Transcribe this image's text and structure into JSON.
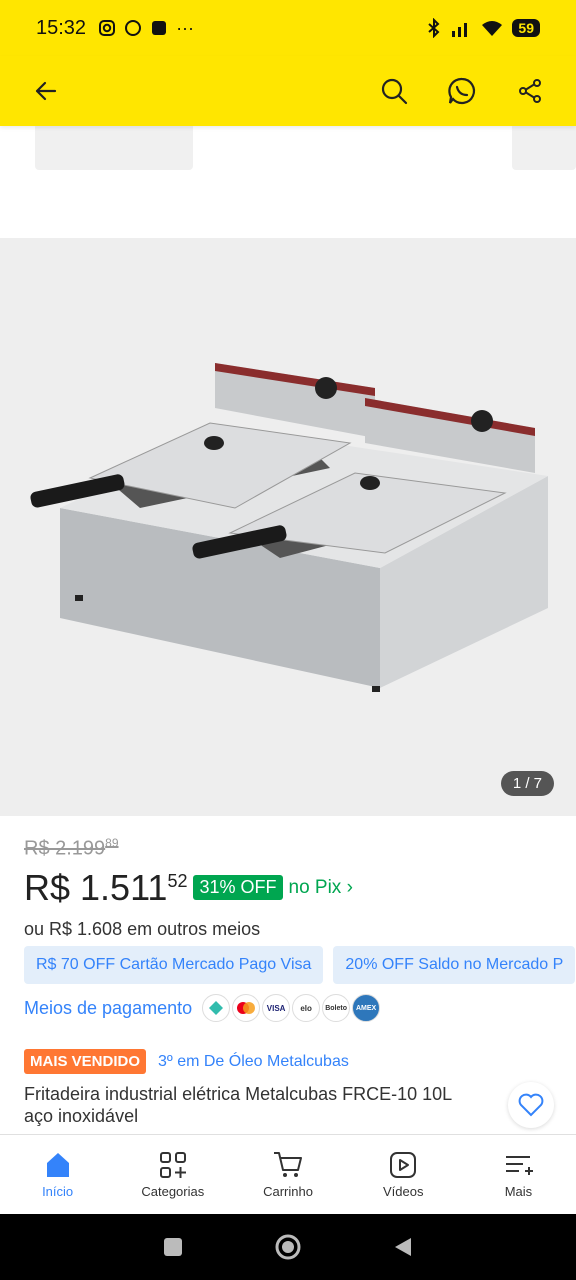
{
  "status_bar": {
    "time": "15:32",
    "battery": "59"
  },
  "gallery": {
    "counter": "1 / 7"
  },
  "price": {
    "old_main": "R$ 2.199",
    "old_cents": "89",
    "current_main": "R$ 1.511",
    "current_cents": "52",
    "discount": "31% OFF",
    "pix_label": "no Pix ›",
    "other_means": "ou R$ 1.608 em outros meios"
  },
  "promos": [
    "R$ 70 OFF Cartão Mercado Pago Visa",
    "20% OFF Saldo no Mercado P"
  ],
  "payment": {
    "label": "Meios de pagamento",
    "methods": [
      "Pix",
      "Mastercard",
      "VISA",
      "elo",
      "Boleto",
      "AMEX"
    ]
  },
  "badge": {
    "label": "MAIS VENDIDO",
    "rank": "3º em De Óleo Metalcubas"
  },
  "product": {
    "title": "Fritadeira industrial elétrica Metalcubas FRCE-10 10L aço inoxidável"
  },
  "tabs": [
    {
      "label": "Início",
      "icon": "home-icon",
      "active": true
    },
    {
      "label": "Categorias",
      "icon": "categories-icon",
      "active": false
    },
    {
      "label": "Carrinho",
      "icon": "cart-icon",
      "active": false
    },
    {
      "label": "Vídeos",
      "icon": "video-icon",
      "active": false
    },
    {
      "label": "Mais",
      "icon": "more-icon",
      "active": false
    }
  ],
  "colors": {
    "brand_yellow": "#ffe600",
    "link_blue": "#3483fa",
    "green": "#00a650",
    "orange": "#ff7733"
  }
}
